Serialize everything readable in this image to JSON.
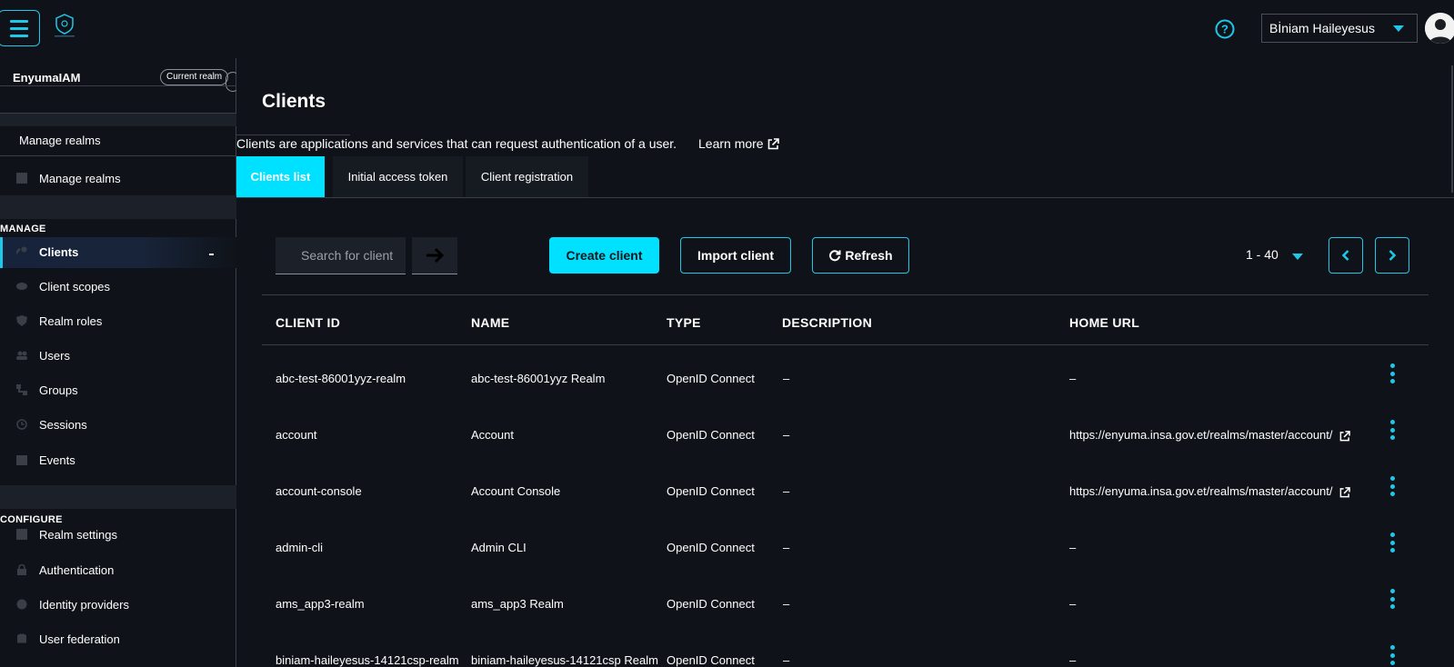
{
  "header": {
    "user_name": "Bİniam Haileyesus",
    "logo_caption": "EnyumaIAM"
  },
  "sidebar": {
    "realm_name": "EnyumaIAM",
    "realm_badge": "Current realm",
    "manage_realms_header": "Manage realms",
    "manage_realms_item": "Manage realms",
    "manage_section": "MANAGE",
    "configure_section": "CONFIGURE",
    "manage_items": [
      {
        "label": "Clients",
        "icon": "key-icon"
      },
      {
        "label": "Client scopes",
        "icon": "eye-icon"
      },
      {
        "label": "Realm roles",
        "icon": "shield-icon"
      },
      {
        "label": "Users",
        "icon": "users-icon"
      },
      {
        "label": "Groups",
        "icon": "groups-icon"
      },
      {
        "label": "Sessions",
        "icon": "clock-icon"
      },
      {
        "label": "Events",
        "icon": "calendar-icon"
      }
    ],
    "configure_items": [
      {
        "label": "Realm settings",
        "icon": "grid-icon"
      },
      {
        "label": "Authentication",
        "icon": "lock-icon"
      },
      {
        "label": "Identity providers",
        "icon": "globe-icon"
      },
      {
        "label": "User federation",
        "icon": "database-icon"
      }
    ]
  },
  "page": {
    "title": "Clients",
    "description": "Clients are applications and services that can request authentication of a user.",
    "learn_more": "Learn more",
    "tabs": [
      "Clients list",
      "Initial access token",
      "Client registration"
    ]
  },
  "toolbar": {
    "search_placeholder": "Search for client",
    "create_client": "Create client",
    "import_client": "Import client",
    "refresh": "Refresh",
    "pagination": "1 - 40"
  },
  "table": {
    "columns": [
      "CLIENT ID",
      "NAME",
      "TYPE",
      "DESCRIPTION",
      "HOME URL"
    ],
    "rows": [
      {
        "client_id": "abc-test-86001yyz-realm",
        "name": "abc-test-86001yyz Realm",
        "type": "OpenID Connect",
        "description": "–",
        "home_url": "–"
      },
      {
        "client_id": "account",
        "name": "Account",
        "type": "OpenID Connect",
        "description": "–",
        "home_url": "https://enyuma.insa.gov.et/realms/master/account/"
      },
      {
        "client_id": "account-console",
        "name": "Account Console",
        "type": "OpenID Connect",
        "description": "–",
        "home_url": "https://enyuma.insa.gov.et/realms/master/account/"
      },
      {
        "client_id": "admin-cli",
        "name": "Admin CLI",
        "type": "OpenID Connect",
        "description": "–",
        "home_url": "–"
      },
      {
        "client_id": "ams_app3-realm",
        "name": "ams_app3 Realm",
        "type": "OpenID Connect",
        "description": "–",
        "home_url": "–"
      },
      {
        "client_id": "biniam-haileyesus-14121csp-realm",
        "name": "biniam-haileyesus-14121csp Realm",
        "type": "OpenID Connect",
        "description": "–",
        "home_url": "–"
      }
    ]
  },
  "colors": {
    "accent": "#00e1ff",
    "background": "#0f1319",
    "panel": "#1c2129"
  }
}
